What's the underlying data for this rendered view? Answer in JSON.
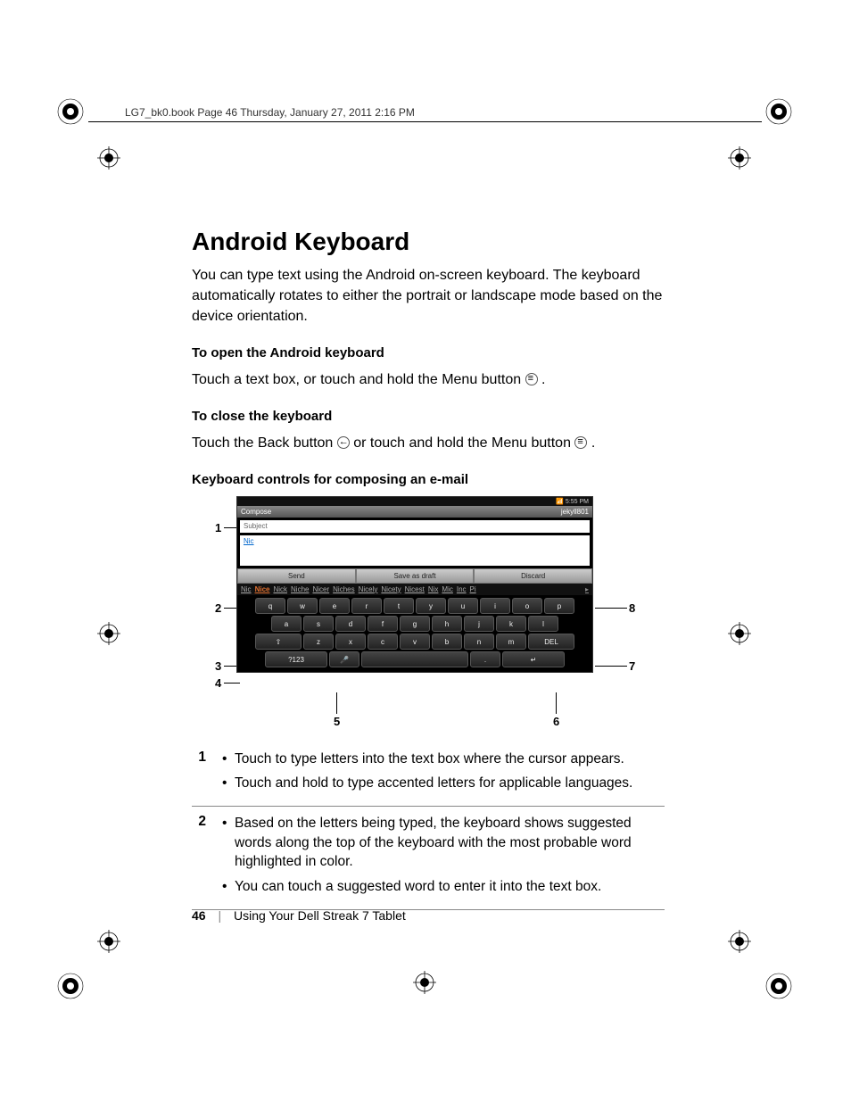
{
  "meta_header": "LG7_bk0.book  Page 46  Thursday, January 27, 2011  2:16 PM",
  "title": "Android Keyboard",
  "intro": "You can type text using the Android on-screen keyboard. The keyboard automatically rotates to either the portrait or landscape mode based on the device orientation.",
  "open_head": "To open the Android keyboard",
  "open_body_a": "Touch a text box, or touch and hold the Menu button ",
  "open_body_b": ".",
  "close_head": "To close the keyboard",
  "close_body_a": "Touch the Back button ",
  "close_body_b": " or touch and hold the Menu button ",
  "close_body_c": ".",
  "controls_head": "Keyboard controls for composing an e-mail",
  "status_text": "5:55 PM",
  "compose": "Compose",
  "acct": "jekyll801",
  "subject": "Subject",
  "typed": "Nic",
  "send": "Send",
  "save_draft": "Save as draft",
  "discard": "Discard",
  "sugg": [
    "Nic",
    "Nice",
    "Nick",
    "Niche",
    "Nicer",
    "Niches",
    "Nicely",
    "Nicety",
    "Nicest",
    "Nix",
    "Mic",
    "Inc",
    "Pi"
  ],
  "row1": [
    "q",
    "w",
    "e",
    "r",
    "t",
    "y",
    "u",
    "i",
    "o",
    "p"
  ],
  "row2": [
    "a",
    "s",
    "d",
    "f",
    "g",
    "h",
    "j",
    "k",
    "l"
  ],
  "row3_shift": "⇧",
  "row3": [
    "z",
    "x",
    "c",
    "v",
    "b",
    "n",
    "m"
  ],
  "row3_del": "DEL",
  "row4_sym": "?123",
  "row4_mic": "🎤",
  "row4_space": " ",
  "row4_dot": ".",
  "row4_ret": "↵",
  "call": {
    "1": "1",
    "2": "2",
    "3": "3",
    "4": "4",
    "5": "5",
    "6": "6",
    "7": "7",
    "8": "8"
  },
  "table": {
    "r1n": "1",
    "r1a": "Touch to type letters into the text box where the cursor appears.",
    "r1b": "Touch and hold to type accented letters for applicable languages.",
    "r2n": "2",
    "r2a": "Based on the letters being typed, the keyboard shows suggested words along the top of the keyboard with the most probable word highlighted in color.",
    "r2b": "You can touch a suggested word to enter it into the text box."
  },
  "page_num": "46",
  "footer_text": "Using Your Dell Streak 7 Tablet"
}
